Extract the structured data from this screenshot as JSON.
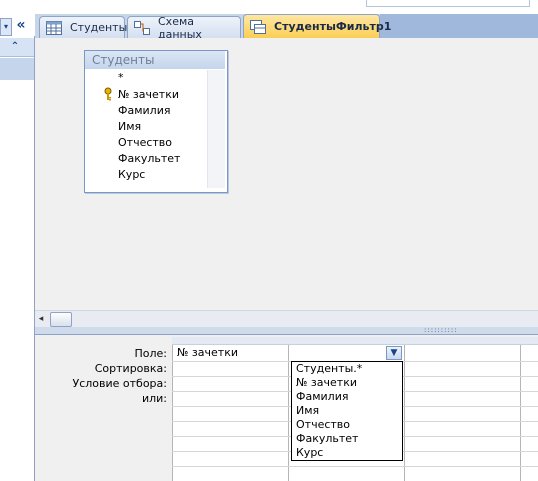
{
  "tabs": [
    {
      "label": "Студенты",
      "icon": "table-icon"
    },
    {
      "label": "Схема данных",
      "icon": "relationships-icon"
    },
    {
      "label": "СтудентыФильтр1",
      "icon": "query-icon",
      "active": true
    }
  ],
  "nav": {
    "collapse_label": "«",
    "group_icon": "chevron-up-icon",
    "dropdown_icon": "chevron-down-icon"
  },
  "table_box": {
    "title": "Студенты",
    "fields": [
      "*",
      "№ зачетки",
      "Фамилия",
      "Имя",
      "Отчество",
      "Факультет",
      "Курс"
    ],
    "primary_key_field": "№ зачетки"
  },
  "grid": {
    "row_labels": [
      "Поле:",
      "Сортировка:",
      "Условие отбора:",
      "или:"
    ],
    "field_value": "№ зачетки"
  },
  "dropdown": {
    "options": [
      "Студенты.*",
      "№ зачетки",
      "Фамилия",
      "Имя",
      "Отчество",
      "Факультет",
      "Курс"
    ]
  },
  "colors": {
    "active_tab": "#fbcf55",
    "ribbon_blue": "#c7d5e9",
    "design_bg": "#f0f0f0"
  }
}
